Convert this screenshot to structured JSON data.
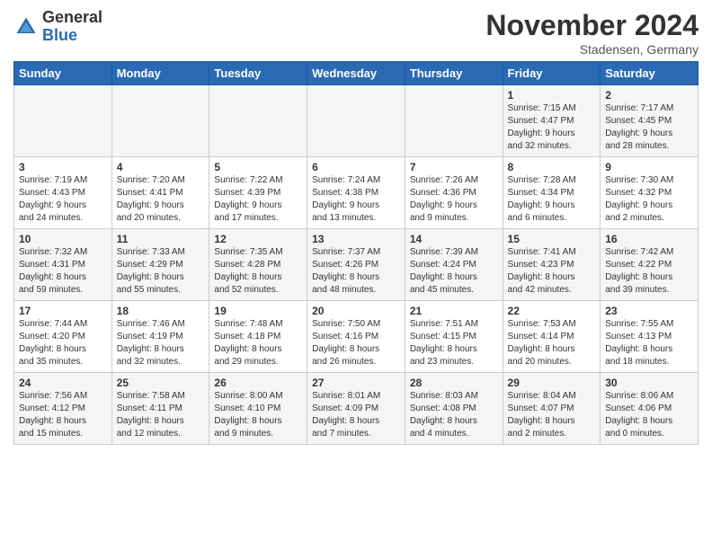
{
  "header": {
    "logo_general": "General",
    "logo_blue": "Blue",
    "month_title": "November 2024",
    "location": "Stadensen, Germany"
  },
  "days_of_week": [
    "Sunday",
    "Monday",
    "Tuesday",
    "Wednesday",
    "Thursday",
    "Friday",
    "Saturday"
  ],
  "weeks": [
    [
      {
        "day": "",
        "info": ""
      },
      {
        "day": "",
        "info": ""
      },
      {
        "day": "",
        "info": ""
      },
      {
        "day": "",
        "info": ""
      },
      {
        "day": "",
        "info": ""
      },
      {
        "day": "1",
        "info": "Sunrise: 7:15 AM\nSunset: 4:47 PM\nDaylight: 9 hours\nand 32 minutes."
      },
      {
        "day": "2",
        "info": "Sunrise: 7:17 AM\nSunset: 4:45 PM\nDaylight: 9 hours\nand 28 minutes."
      }
    ],
    [
      {
        "day": "3",
        "info": "Sunrise: 7:19 AM\nSunset: 4:43 PM\nDaylight: 9 hours\nand 24 minutes."
      },
      {
        "day": "4",
        "info": "Sunrise: 7:20 AM\nSunset: 4:41 PM\nDaylight: 9 hours\nand 20 minutes."
      },
      {
        "day": "5",
        "info": "Sunrise: 7:22 AM\nSunset: 4:39 PM\nDaylight: 9 hours\nand 17 minutes."
      },
      {
        "day": "6",
        "info": "Sunrise: 7:24 AM\nSunset: 4:38 PM\nDaylight: 9 hours\nand 13 minutes."
      },
      {
        "day": "7",
        "info": "Sunrise: 7:26 AM\nSunset: 4:36 PM\nDaylight: 9 hours\nand 9 minutes."
      },
      {
        "day": "8",
        "info": "Sunrise: 7:28 AM\nSunset: 4:34 PM\nDaylight: 9 hours\nand 6 minutes."
      },
      {
        "day": "9",
        "info": "Sunrise: 7:30 AM\nSunset: 4:32 PM\nDaylight: 9 hours\nand 2 minutes."
      }
    ],
    [
      {
        "day": "10",
        "info": "Sunrise: 7:32 AM\nSunset: 4:31 PM\nDaylight: 8 hours\nand 59 minutes."
      },
      {
        "day": "11",
        "info": "Sunrise: 7:33 AM\nSunset: 4:29 PM\nDaylight: 8 hours\nand 55 minutes."
      },
      {
        "day": "12",
        "info": "Sunrise: 7:35 AM\nSunset: 4:28 PM\nDaylight: 8 hours\nand 52 minutes."
      },
      {
        "day": "13",
        "info": "Sunrise: 7:37 AM\nSunset: 4:26 PM\nDaylight: 8 hours\nand 48 minutes."
      },
      {
        "day": "14",
        "info": "Sunrise: 7:39 AM\nSunset: 4:24 PM\nDaylight: 8 hours\nand 45 minutes."
      },
      {
        "day": "15",
        "info": "Sunrise: 7:41 AM\nSunset: 4:23 PM\nDaylight: 8 hours\nand 42 minutes."
      },
      {
        "day": "16",
        "info": "Sunrise: 7:42 AM\nSunset: 4:22 PM\nDaylight: 8 hours\nand 39 minutes."
      }
    ],
    [
      {
        "day": "17",
        "info": "Sunrise: 7:44 AM\nSunset: 4:20 PM\nDaylight: 8 hours\nand 35 minutes."
      },
      {
        "day": "18",
        "info": "Sunrise: 7:46 AM\nSunset: 4:19 PM\nDaylight: 8 hours\nand 32 minutes."
      },
      {
        "day": "19",
        "info": "Sunrise: 7:48 AM\nSunset: 4:18 PM\nDaylight: 8 hours\nand 29 minutes."
      },
      {
        "day": "20",
        "info": "Sunrise: 7:50 AM\nSunset: 4:16 PM\nDaylight: 8 hours\nand 26 minutes."
      },
      {
        "day": "21",
        "info": "Sunrise: 7:51 AM\nSunset: 4:15 PM\nDaylight: 8 hours\nand 23 minutes."
      },
      {
        "day": "22",
        "info": "Sunrise: 7:53 AM\nSunset: 4:14 PM\nDaylight: 8 hours\nand 20 minutes."
      },
      {
        "day": "23",
        "info": "Sunrise: 7:55 AM\nSunset: 4:13 PM\nDaylight: 8 hours\nand 18 minutes."
      }
    ],
    [
      {
        "day": "24",
        "info": "Sunrise: 7:56 AM\nSunset: 4:12 PM\nDaylight: 8 hours\nand 15 minutes."
      },
      {
        "day": "25",
        "info": "Sunrise: 7:58 AM\nSunset: 4:11 PM\nDaylight: 8 hours\nand 12 minutes."
      },
      {
        "day": "26",
        "info": "Sunrise: 8:00 AM\nSunset: 4:10 PM\nDaylight: 8 hours\nand 9 minutes."
      },
      {
        "day": "27",
        "info": "Sunrise: 8:01 AM\nSunset: 4:09 PM\nDaylight: 8 hours\nand 7 minutes."
      },
      {
        "day": "28",
        "info": "Sunrise: 8:03 AM\nSunset: 4:08 PM\nDaylight: 8 hours\nand 4 minutes."
      },
      {
        "day": "29",
        "info": "Sunrise: 8:04 AM\nSunset: 4:07 PM\nDaylight: 8 hours\nand 2 minutes."
      },
      {
        "day": "30",
        "info": "Sunrise: 8:06 AM\nSunset: 4:06 PM\nDaylight: 8 hours\nand 0 minutes."
      }
    ]
  ]
}
